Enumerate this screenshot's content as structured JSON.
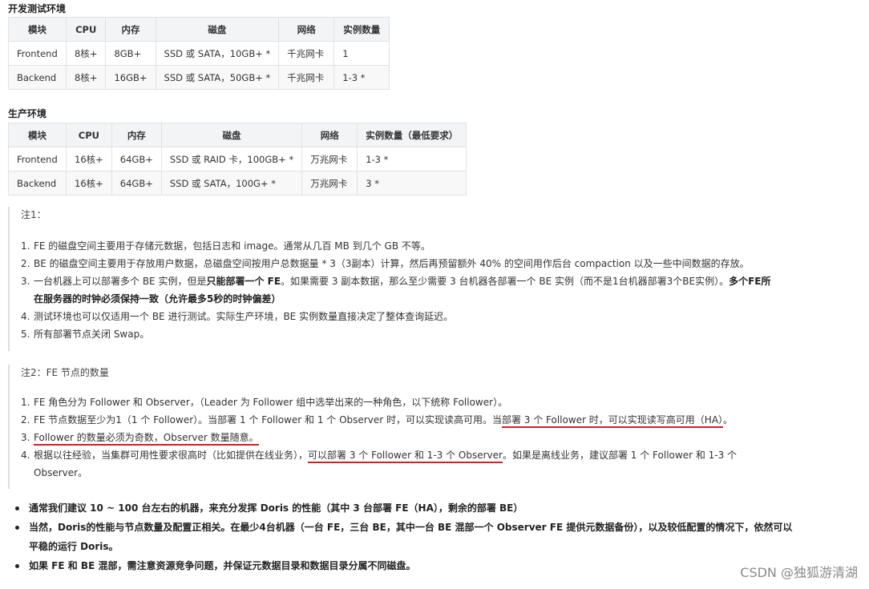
{
  "dev": {
    "title": "开发测试环境",
    "headers": [
      "模块",
      "CPU",
      "内存",
      "磁盘",
      "网络",
      "实例数量"
    ],
    "rows": [
      [
        "Frontend",
        "8核+",
        "8GB+",
        "SSD 或 SATA，10GB+ *",
        "千兆网卡",
        "1"
      ],
      [
        "Backend",
        "8核+",
        "16GB+",
        "SSD 或 SATA，50GB+ *",
        "千兆网卡",
        "1-3 *"
      ]
    ]
  },
  "prod": {
    "title": "生产环境",
    "headers": [
      "模块",
      "CPU",
      "内存",
      "磁盘",
      "网络",
      "实例数量（最低要求）"
    ],
    "rows": [
      [
        "Frontend",
        "16核+",
        "64GB+",
        "SSD 或 RAID 卡，100GB+ *",
        "万兆网卡",
        "1-3 *"
      ],
      [
        "Backend",
        "16核+",
        "64GB+",
        "SSD 或 SATA，100G+ *",
        "万兆网卡",
        "3 *"
      ]
    ]
  },
  "note1": {
    "title": "注1：",
    "items": [
      {
        "n": "1.",
        "t": "FE 的磁盘空间主要用于存储元数据，包括日志和 image。通常从几百 MB 到几个 GB 不等。"
      },
      {
        "n": "2.",
        "t": "BE 的磁盘空间主要用于存放用户数据，总磁盘空间按用户总数据量 * 3（3副本）计算，然后再预留额外 40% 的空间用作后台 compaction 以及一些中间数据的存放。"
      },
      {
        "n": "3.",
        "a": "一台机器上可以部署多个 BE 实例，但是",
        "b": "只能部署一个 FE",
        "c": "。如果需要 3 副本数据，那么至少需要 3 台机器各部署一个 BE 实例（而不是1台机器部署3个BE实例）。",
        "d": "多个FE所",
        "e": "在服务器的时钟必须保持一致（允许最多5秒的时钟偏差）"
      },
      {
        "n": "4.",
        "t": "测试环境也可以仅适用一个 BE 进行测试。实际生产环境，BE 实例数量直接决定了整体查询延迟。"
      },
      {
        "n": "5.",
        "t": "所有部署节点关闭 Swap。"
      }
    ]
  },
  "note2": {
    "title": "注2：FE 节点的数量",
    "items": [
      {
        "n": "1.",
        "t": "FE 角色分为 Follower 和 Observer，（Leader 为 Follower 组中选举出来的一种角色，以下统称 Follower）。"
      },
      {
        "n": "2.",
        "a": "FE 节点数据至少为1（1 个 Follower）。当部署 1 个 Follower 和 1 个 Observer 时，可以实现读高可用。当",
        "b": "部署 3 个 Follower 时，可以实现读写高可用（HA）",
        "c": "。"
      },
      {
        "n": "3.",
        "t": "Follower 的数量必须为奇数，Observer 数量随意。"
      },
      {
        "n": "4.",
        "a": "根据以往经验，当集群可用性要求很高时（比如提供在线业务），",
        "b": "可以部署 3 个 Follower 和 1-3 个 Observer",
        "c": "。如果是离线业务，建议部署 1 个 Follower 和 1-3 个",
        "d": "Observer。"
      }
    ]
  },
  "bullets": [
    "通常我们建议 10 ~ 100 台左右的机器，来充分发挥 Doris 的性能（其中 3 台部署 FE（HA），剩余的部署 BE）",
    "当然，Doris的性能与节点数量及配置正相关。在最少4台机器（一台 FE，三台 BE，其中一台 BE 混部一个 Observer FE 提供元数据备份），以及较低配置的情况下，依然可以",
    "平稳的运行 Doris。",
    "如果 FE 和 BE 混部，需注意资源竞争问题，并保证元数据目录和数据目录分属不同磁盘。"
  ],
  "watermark": "CSDN @独狐游清湖"
}
